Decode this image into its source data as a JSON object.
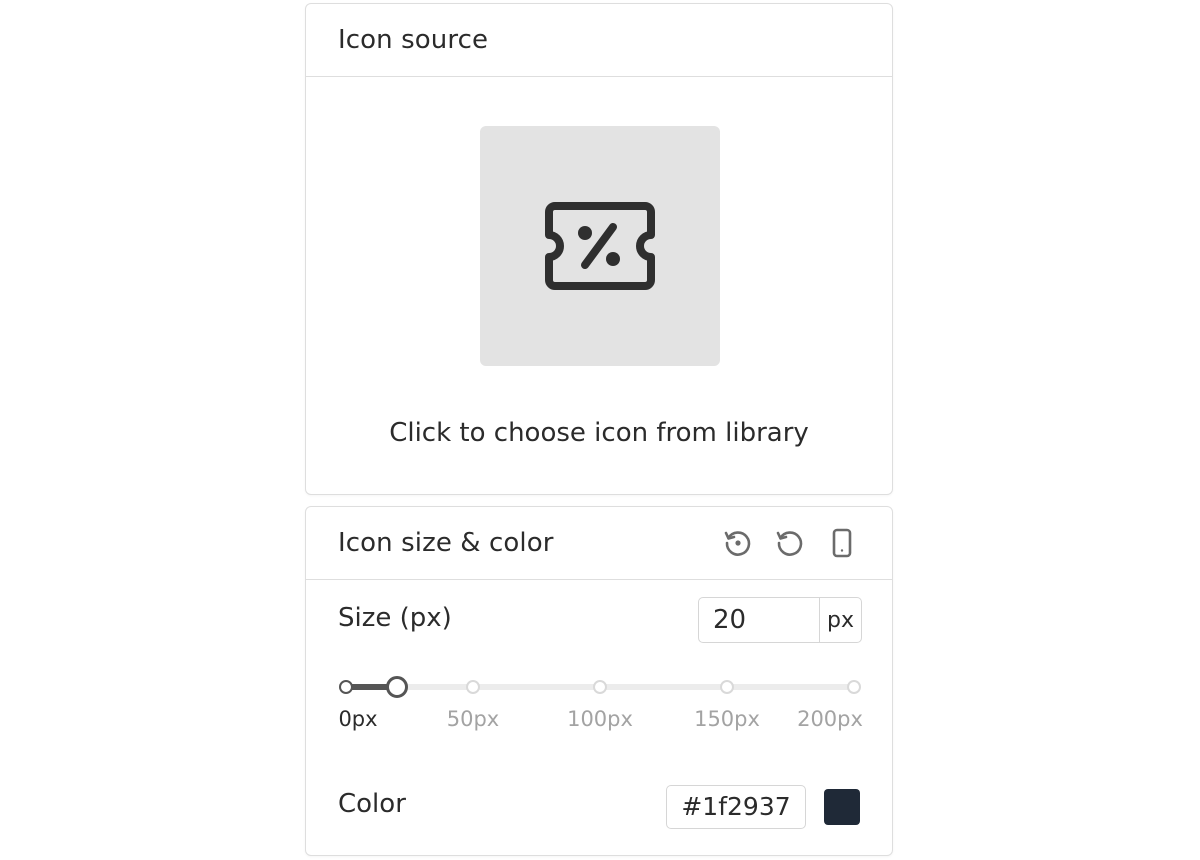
{
  "icon_source": {
    "title": "Icon source",
    "icon": "ticket-percent-icon",
    "choose_label": "Click to choose icon from library"
  },
  "size_color": {
    "title": "Icon size & color",
    "header_icons": [
      "history-icon",
      "reset-icon",
      "mobile-device-icon"
    ],
    "size_label": "Size (px)",
    "size_value": "20",
    "size_unit": "px",
    "slider": {
      "min": 0,
      "max": 200,
      "value": 20,
      "ticks": [
        {
          "value": 0,
          "label": "0px"
        },
        {
          "value": 50,
          "label": "50px"
        },
        {
          "value": 100,
          "label": "100px"
        },
        {
          "value": 150,
          "label": "150px"
        },
        {
          "value": 200,
          "label": "200px"
        }
      ]
    },
    "color_label": "Color",
    "color_value": "#1f2937",
    "accent_color": "#555555"
  }
}
